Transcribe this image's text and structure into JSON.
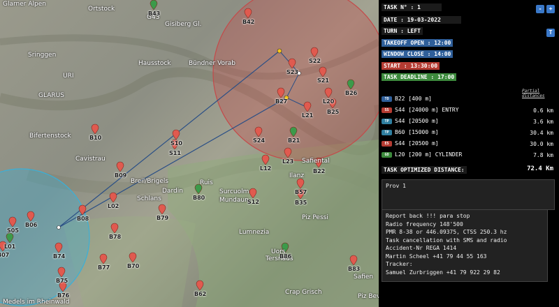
{
  "map": {
    "place_labels": [
      "Glarner Alpen",
      "Ortstock",
      "G43",
      "Gisiberg Gl.",
      "Hausstock",
      "Bündner Vorab",
      "URI",
      "GLARUS",
      "Sringgen",
      "Bifertenstock",
      "Cavistrau",
      "Breil/Brigels",
      "Ruis",
      "Surcuolm",
      "Mundaun",
      "Dardin",
      "Schlans",
      "Lumnezia",
      "Piz Pessi",
      "Ilanz",
      "Safiental",
      "Tersnaus",
      "Uors",
      "Crap Grisch",
      "Piz Bever",
      "Safien",
      "Medels im Rheinwald"
    ],
    "waypoints": [
      "B43",
      "B42",
      "S22",
      "S23",
      "B25",
      "S21",
      "L20",
      "B26",
      "L21",
      "B27",
      "S24",
      "B10",
      "S10",
      "S11",
      "B21",
      "L23",
      "B22",
      "B09",
      "L12",
      "B57",
      "S12",
      "B80",
      "B35",
      "L02",
      "B08",
      "B79",
      "B06",
      "S05",
      "L01",
      "B07",
      "B78",
      "B74",
      "B77",
      "B70",
      "B75",
      "B86",
      "B76",
      "B62",
      "B83"
    ]
  },
  "panel": {
    "task_label": "TASK N° : 1",
    "date": "DATE : 19-03-2022",
    "turn": "TURN : LEFT",
    "takeoff_open": "TAKEOFF OPEN : 12:00",
    "window_close": "WINDOW CLOSE : 14:00",
    "start": "START : 13:30:00",
    "task_deadline": "TASK DEADLINE : 17:00",
    "minus_btn": "-",
    "plus_btn": "+",
    "t_btn": "T",
    "partial_distances": "Partial distances",
    "legs": [
      {
        "badge": "TO",
        "badge_color": "#2f5f9a",
        "text": "B22 [400 m]",
        "dist": ""
      },
      {
        "badge": "SS",
        "badge_color": "#b53b32",
        "text": "S44 [24000 m] ENTRY",
        "dist": "0.6 km"
      },
      {
        "badge": "TP",
        "badge_color": "#2f7fa0",
        "text": "S44 [20500 m]",
        "dist": "3.6 km"
      },
      {
        "badge": "TP",
        "badge_color": "#2f7fa0",
        "text": "B60 [15000 m]",
        "dist": "30.4 km"
      },
      {
        "badge": "ES",
        "badge_color": "#b53b32",
        "text": "S44 [20500 m]",
        "dist": "30.0 km"
      },
      {
        "badge": "GO",
        "badge_color": "#3c8a3c",
        "text": "L20 [200 m] CYLINDER",
        "dist": "7.8 km"
      }
    ],
    "optimized_label": "TASK OPTIMIZED DISTANCE:",
    "optimized_value": "72.4 Km",
    "prov": "Prov 1",
    "notes": [
      "Report back !!! para stop",
      "Radio frequency 148'500",
      "PMR 8-38 or 446.09375, CTSS 250.3 hz",
      "Task cancellation with SMS and radio",
      "Accident-Nr REGA 1414",
      "Martin Scheel +41 79 44 55 163",
      "Tracker:",
      "Samuel Zurbriggen +41 79 922 29 82"
    ]
  }
}
